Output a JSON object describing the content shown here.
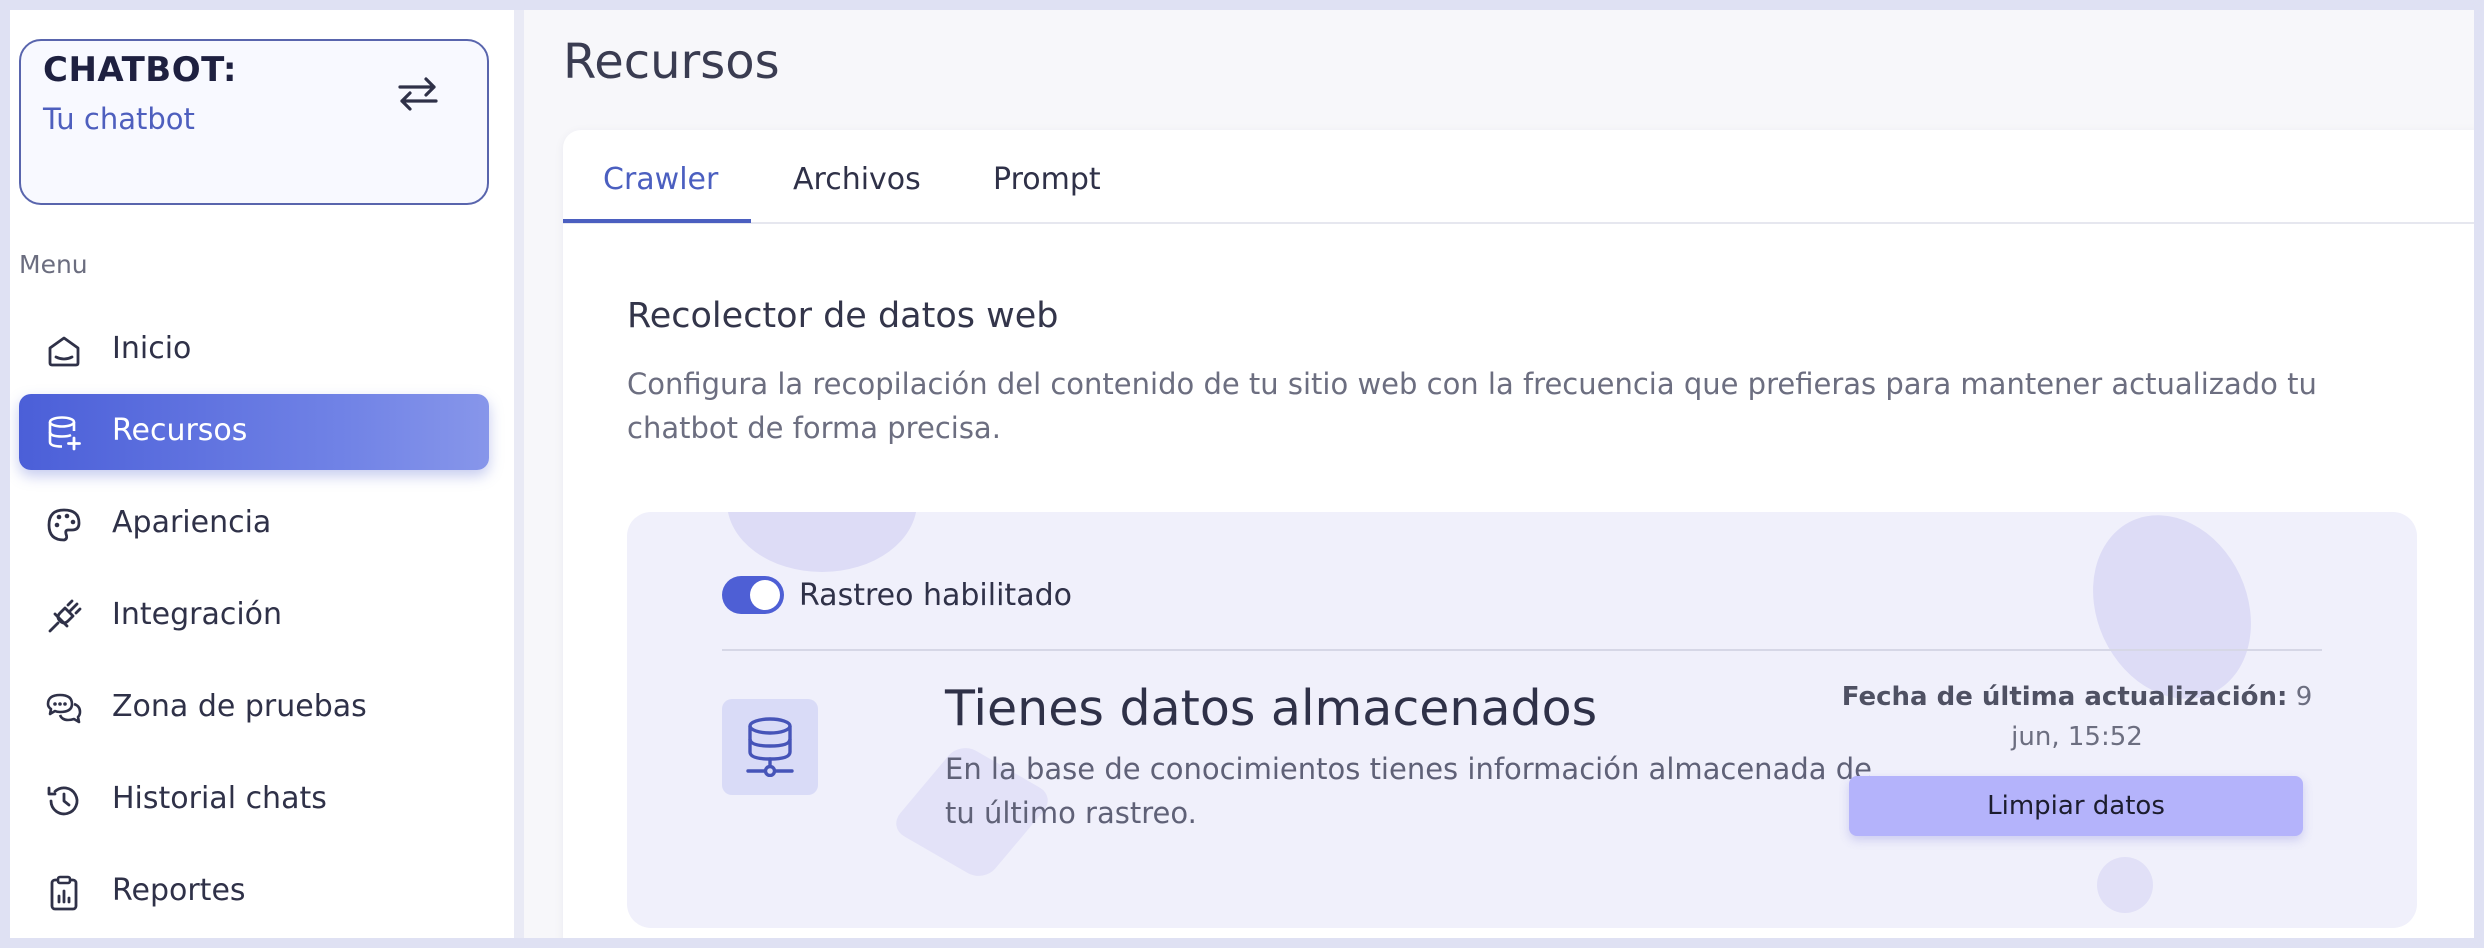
{
  "sidebar": {
    "bot_card": {
      "title": "CHATBOT:",
      "name": "Tu chatbot"
    },
    "menu_label": "Menu",
    "items": [
      {
        "label": "Inicio",
        "icon": "home-icon",
        "active": false
      },
      {
        "label": "Recursos",
        "icon": "database-plus-icon",
        "active": true
      },
      {
        "label": "Apariencia",
        "icon": "palette-icon",
        "active": false
      },
      {
        "label": "Integración",
        "icon": "plug-icon",
        "active": false
      },
      {
        "label": "Zona de pruebas",
        "icon": "chat-bubbles-icon",
        "active": false
      },
      {
        "label": "Historial chats",
        "icon": "history-icon",
        "active": false
      },
      {
        "label": "Reportes",
        "icon": "clipboard-icon",
        "active": false
      }
    ]
  },
  "main": {
    "page_title": "Recursos",
    "tabs": [
      {
        "label": "Crawler",
        "active": true
      },
      {
        "label": "Archivos",
        "active": false
      },
      {
        "label": "Prompt",
        "active": false
      }
    ],
    "section": {
      "title": "Recolector de datos web",
      "description": "Configura la recopilación del contenido de tu sitio web con la frecuencia que prefieras para mantener actualizado tu chatbot de forma precisa."
    },
    "crawler": {
      "toggle_label": "Rastreo habilitado",
      "toggle_on": true,
      "stored_title": "Tienes datos almacenados",
      "stored_description": "En la base de conocimientos tienes información almacenada de tu último rastreo.",
      "updated_label": "Fecha de última actualización:",
      "updated_value": "9 jun, 15:52",
      "clear_button": "Limpiar datos"
    }
  },
  "colors": {
    "accent": "#4b5fc0",
    "active_nav": "#4b5fd8",
    "toggle": "#4e5fd5",
    "button": "#b4b3fb"
  }
}
